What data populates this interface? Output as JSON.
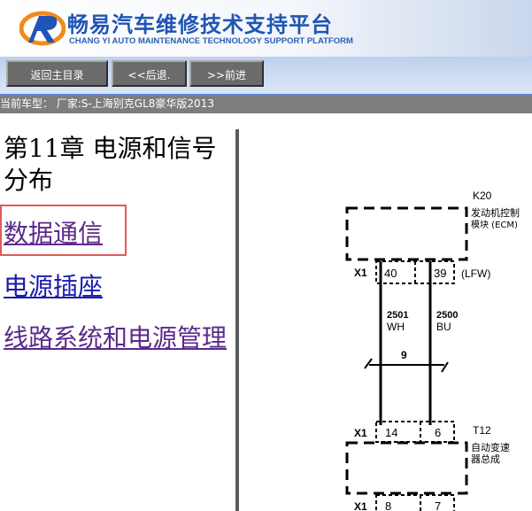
{
  "header": {
    "brand_cn": "畅易汽车维修技术支持平台",
    "brand_en": "CHANG YI AUTO MAINTENANCE TECHNOLOGY SUPPORT PLATFORM",
    "colors": {
      "brand_blue": "#1f55b6",
      "logo_orange": "#f08a1c"
    }
  },
  "nav": {
    "home_label": "返回主目录",
    "back_label": "<<后退.",
    "forward_label": ">>前进"
  },
  "vehicle": {
    "text": "当前车型： 厂家:S-上海别克GL8豪华版2013"
  },
  "toc": {
    "chapter_title": "第11章 电源和信号分布",
    "links": [
      "数据通信",
      "电源插座",
      "线路系统和电源管理"
    ]
  },
  "diagram": {
    "k20_code": "K20",
    "k20_name_line1": "发动机控制",
    "k20_name_line2": "模块 (ECM)",
    "x1_label": "X1",
    "pin_40": "40",
    "pin_39": "39",
    "lfw": "(LFW)",
    "wire_2501": "2501",
    "wire_2500": "2500",
    "color_wh": "WH",
    "color_bu": "BU",
    "twist_count": "9",
    "t12_code": "T12",
    "t12_name_line1": "自动变速",
    "t12_name_line2": "器总成",
    "x1_label_b": "X1",
    "pin_14": "14",
    "pin_6": "6",
    "x1_label_c": "X1",
    "pin_8": "8",
    "pin_7": "7"
  }
}
